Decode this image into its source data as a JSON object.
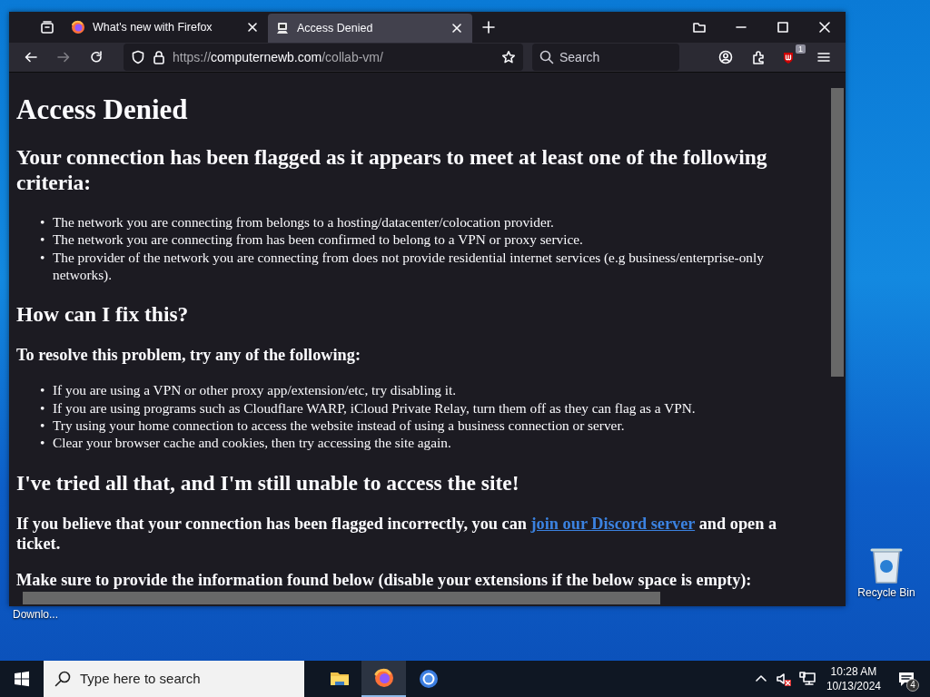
{
  "desktop": {
    "icons": [
      {
        "label": "Recycle Bin"
      }
    ],
    "partial_label": "Downlo..."
  },
  "browser": {
    "tabs": [
      {
        "title": "What's new with Firefox",
        "kind": "firefox",
        "selected": false
      },
      {
        "title": "Access Denied",
        "kind": "computer",
        "selected": true
      }
    ],
    "nav_buttons": [
      {
        "kind": "back",
        "disabled": false
      },
      {
        "kind": "forward",
        "disabled": true
      },
      {
        "kind": "reload",
        "disabled": false
      }
    ],
    "url": {
      "scheme": "https://",
      "host": "computernewb.com",
      "path": "/collab-vm/"
    },
    "search": {
      "placeholder": "Search"
    },
    "extension_badge": "1"
  },
  "page": {
    "blocks": [
      {
        "kind": "h1",
        "text": "Access Denied"
      },
      {
        "kind": "h2",
        "text": "Your connection has been flagged as it appears to meet at least one of the following criteria:"
      },
      {
        "kind": "list",
        "marker": "•",
        "items": [
          "The network you are connecting from belongs to a hosting/datacenter/colocation provider.",
          "The network you are connecting from has been confirmed to belong to a VPN or proxy service.",
          "The provider of the network you are connecting from does not provide residential internet services (e.g business/enterprise-only networks)."
        ]
      },
      {
        "kind": "h2",
        "text": "How can I fix this?"
      },
      {
        "kind": "h3",
        "text": "To resolve this problem, try any of the following:"
      },
      {
        "kind": "list",
        "marker": "•",
        "items": [
          "If you are using a VPN or other proxy app/extension/etc, try disabling it.",
          "If you are using programs such as Cloudflare WARP, iCloud Private Relay, turn them off as they can flag as a VPN.",
          "Try using your home connection to access the website instead of using a business connection or server.",
          "Clear your browser cache and cookies, then try accessing the site again."
        ]
      },
      {
        "kind": "h2",
        "text": "I've tried all that, and I'm still unable to access the site!"
      },
      {
        "kind": "h3",
        "parts": [
          {
            "kind": "text",
            "text": "If you believe that your connection has been flagged incorrectly, you can "
          },
          {
            "kind": "link",
            "text": "join our Discord server"
          },
          {
            "kind": "text",
            "text": " and open a ticket."
          }
        ]
      },
      {
        "kind": "h3",
        "text": "Make sure to provide the information found below (disable your extensions if the below space is empty):"
      }
    ]
  },
  "taskbar": {
    "search": {
      "placeholder": "Type here to search"
    },
    "apps": [
      {
        "kind": "files",
        "selected": false
      },
      {
        "kind": "firefox",
        "selected": true
      },
      {
        "kind": "chrome",
        "selected": false
      }
    ],
    "time": "10:28 AM",
    "date": "10/13/2024",
    "notifications": "4"
  }
}
